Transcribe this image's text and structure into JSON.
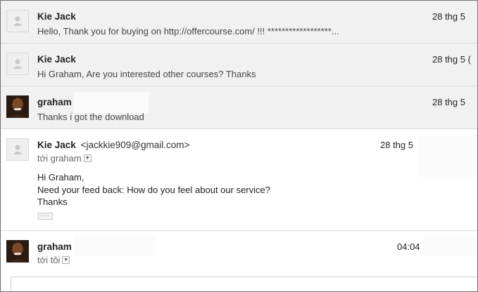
{
  "messages": [
    {
      "sender": "Kie Jack",
      "snippet": "Hello, Thank you for buying on http://offercourse.com/ !!! ******************...",
      "date": "28 thg 5"
    },
    {
      "sender": "Kie Jack",
      "snippet": "Hi Graham, Are you interested other courses? Thanks",
      "date": "28 thg 5 ("
    },
    {
      "sender": "graham",
      "snippet": "Thanks i got the download",
      "date": "28 thg 5"
    },
    {
      "sender": "Kie Jack",
      "email": "<jackkie909@gmail.com>",
      "to": "tới graham",
      "date": "28 thg 5",
      "body": [
        "Hi Graham,",
        "Need your feed back: How do you feel about our service?",
        "Thanks"
      ],
      "show_trimmed_label": "···"
    },
    {
      "sender": "graham",
      "to": "tới tôi",
      "time": "04:04"
    }
  ],
  "icons": {
    "default_avatar": "person-silhouette-icon",
    "photo_avatar": "profile-photo-avatar",
    "details_toggle": "chevron-down-icon"
  },
  "colors": {
    "collapsed_bg": "#f1f1f1",
    "expanded_bg": "#ffffff",
    "border": "#d9d9d9"
  }
}
